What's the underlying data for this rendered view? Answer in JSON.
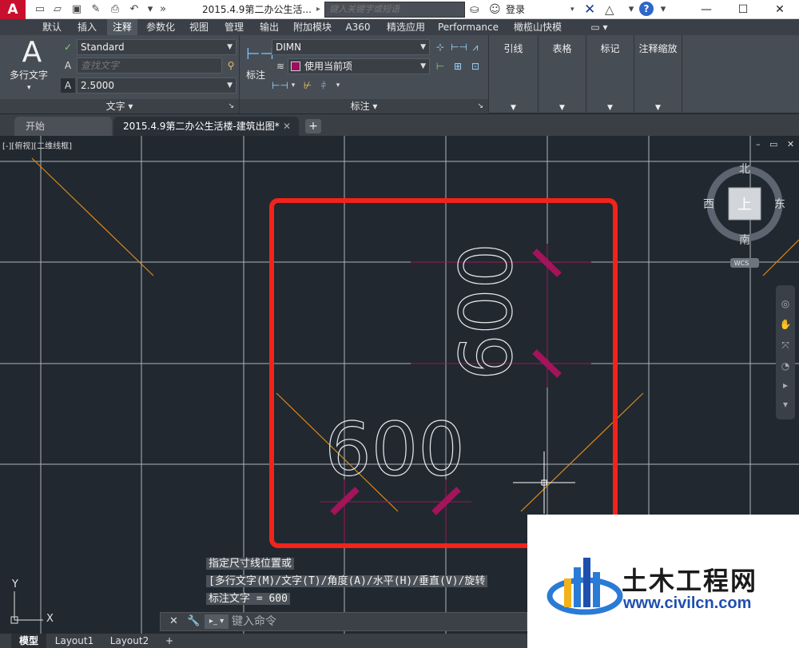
{
  "title_bar": {
    "document_title": "2015.4.9第二办公生活...",
    "search_placeholder": "键入关键字或短语",
    "login_label": "登录",
    "icons": [
      "autocad-logo-icon",
      "new-icon",
      "open-icon",
      "save-icon",
      "saveas-icon",
      "print-icon",
      "undo-icon",
      "more-icon",
      "binoculars-icon",
      "user-icon",
      "exchange-icon",
      "triangle-icon",
      "help-icon",
      "minimize-icon",
      "maximize-icon",
      "close-icon"
    ]
  },
  "ribbon_tabs": [
    "默认",
    "插入",
    "注释",
    "参数化",
    "视图",
    "管理",
    "输出",
    "附加模块",
    "A360",
    "精选应用",
    "Performance",
    "橄榄山快模"
  ],
  "active_ribbon_tab": "注释",
  "text_panel": {
    "big_button_label": "多行文字",
    "text_style": "Standard",
    "find_placeholder": "查找文字",
    "text_height": "2.5000",
    "footer": "文字"
  },
  "dimension_panel": {
    "big_button_label": "标注",
    "dim_style": "DIMN",
    "layer": "使用当前项",
    "layer_color": "#9c0f5f",
    "footer": "标注"
  },
  "panel_buttons": [
    "引线",
    "表格",
    "标记",
    "注释缩放"
  ],
  "file_tabs": {
    "start": "开始",
    "document": "2015.4.9第二办公生活楼-建筑出图*"
  },
  "viewport": {
    "label": "[-][俯视][二维线框]",
    "viewcube_top": "上",
    "north": "北",
    "south": "南",
    "east": "东",
    "west": "西",
    "wcs": "WCS"
  },
  "drawing": {
    "dimension_vertical": "600",
    "dimension_horizontal": "600",
    "ucs_x": "X",
    "ucs_y": "Y",
    "highlight_color": "#f2231a",
    "tick_color": "#a3145a",
    "guide_color": "#d98a17"
  },
  "command": {
    "history": [
      "指定尺寸线位置或",
      "[多行文字(M)/文字(T)/角度(A)/水平(H)/垂直(V)/旋转",
      "标注文字 = 600"
    ],
    "input_placeholder": "键入命令"
  },
  "layout_tabs": [
    "模型",
    "Layout1",
    "Layout2"
  ],
  "active_layout": "模型",
  "watermark": {
    "name": "土木工程网",
    "url": "www.civilcn.com"
  }
}
